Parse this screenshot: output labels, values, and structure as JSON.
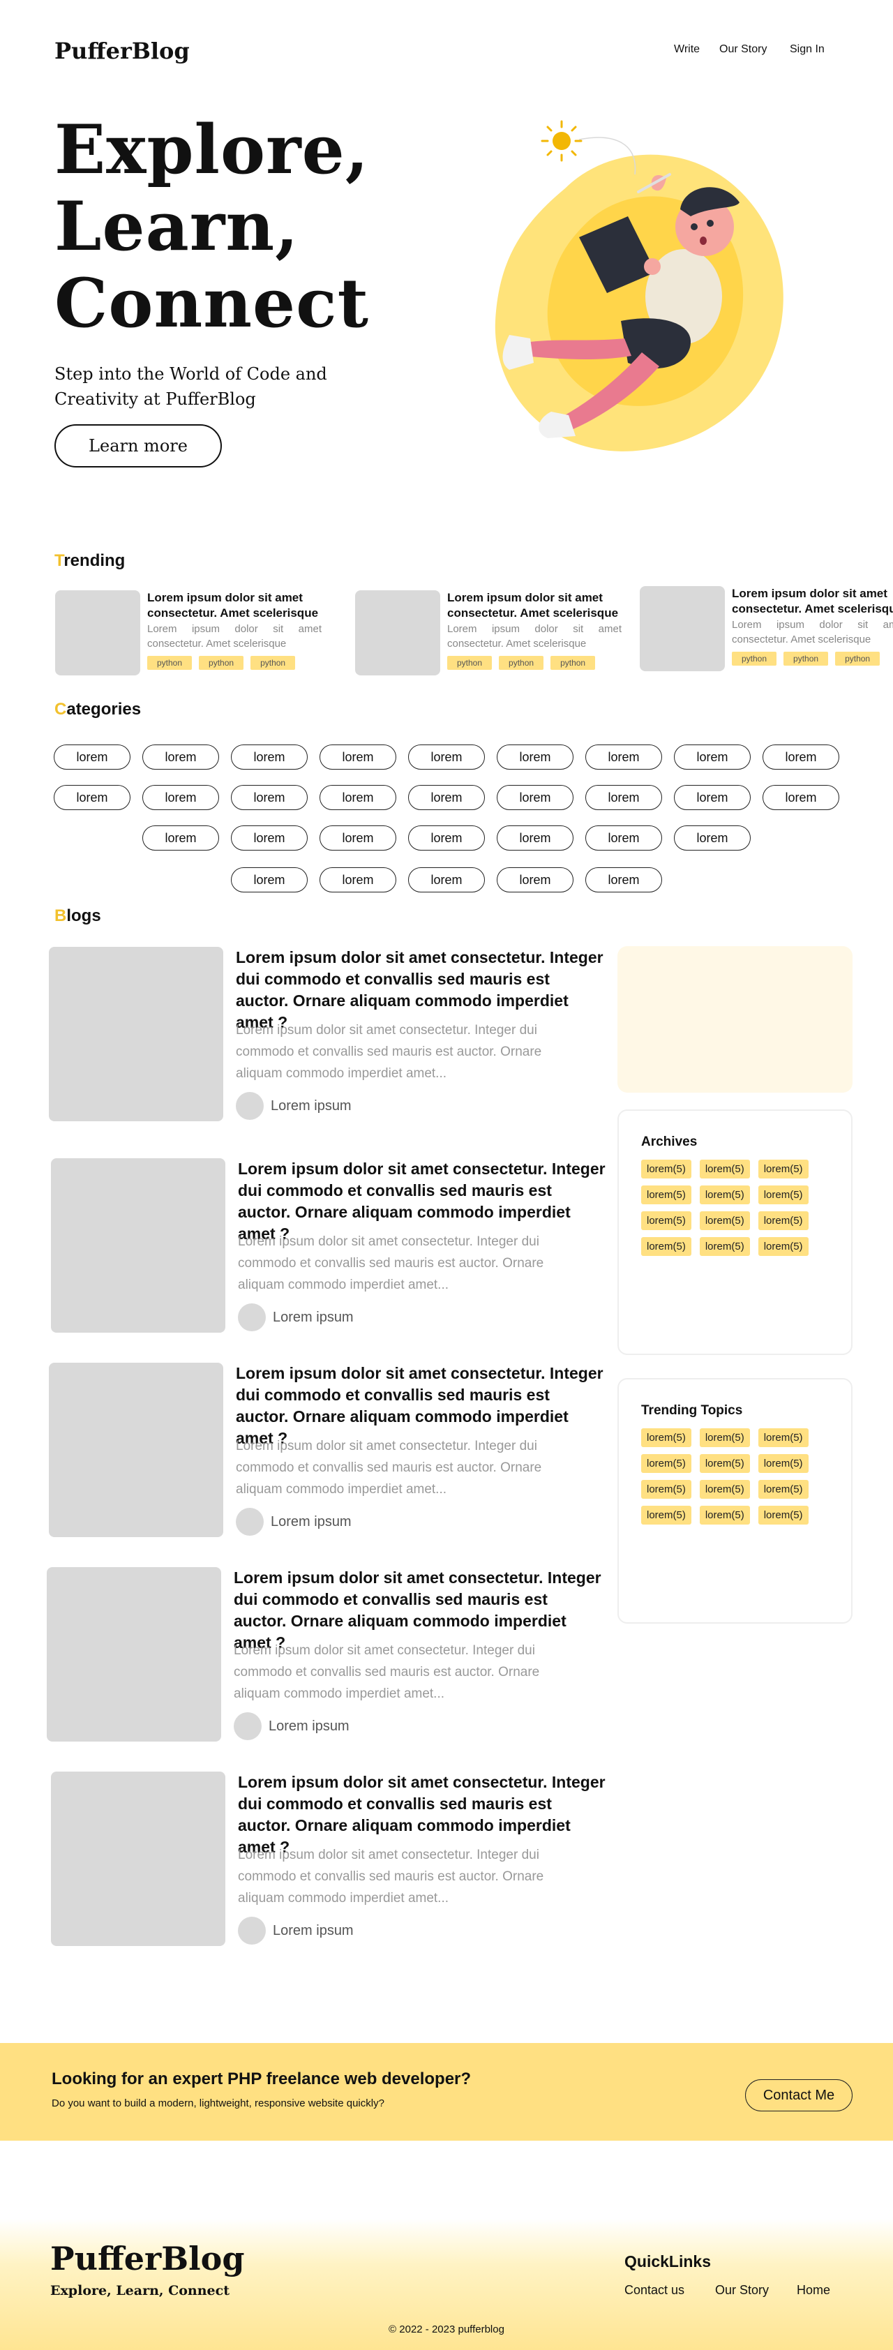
{
  "header": {
    "logo": "PufferBlog",
    "nav": [
      "Write",
      "Our Story",
      "Sign In"
    ]
  },
  "hero": {
    "title_lines": [
      "Explore,",
      "Learn,",
      "Connect"
    ],
    "subtitle": "Step into the World of Code and Creativity at PufferBlog",
    "button": "Learn more"
  },
  "trending": {
    "title_first": "T",
    "title_rest": "rending",
    "items": [
      {
        "title": "Lorem ipsum dolor sit amet consectetur. Amet scelerisque",
        "desc": "Lorem ipsum dolor sit amet consectetur. Amet scelerisque",
        "tags": [
          "python",
          "python",
          "python"
        ]
      },
      {
        "title": "Lorem ipsum dolor sit amet consectetur. Amet scelerisque",
        "desc": "Lorem ipsum dolor sit amet consectetur. Amet scelerisque",
        "tags": [
          "python",
          "python",
          "python"
        ]
      },
      {
        "title": "Lorem ipsum dolor sit amet consectetur. Amet scelerisque",
        "desc": "Lorem ipsum dolor sit amet consectetur. Amet scelerisque",
        "tags": [
          "python",
          "python",
          "python"
        ]
      }
    ]
  },
  "categories": {
    "title_first": "C",
    "title_rest": "ategories",
    "rows": [
      [
        "lorem",
        "lorem",
        "lorem",
        "lorem",
        "lorem",
        "lorem",
        "lorem",
        "lorem",
        "lorem"
      ],
      [
        "lorem",
        "lorem",
        "lorem",
        "lorem",
        "lorem",
        "lorem",
        "lorem",
        "lorem",
        "lorem"
      ],
      [
        "lorem",
        "lorem",
        "lorem",
        "lorem",
        "lorem",
        "lorem",
        "lorem"
      ],
      [
        "lorem",
        "lorem",
        "lorem",
        "lorem",
        "lorem"
      ]
    ]
  },
  "blogs": {
    "title_first": "B",
    "title_rest": "logs",
    "items": [
      {
        "title": "Lorem ipsum dolor sit amet consectetur. Integer dui commodo et convallis sed mauris est auctor. Ornare aliquam commodo imperdiet amet ?",
        "desc": "Lorem ipsum dolor sit amet consectetur. Integer dui commodo et convallis sed mauris est auctor. Ornare aliquam commodo imperdiet amet...",
        "author": "Lorem ipsum"
      },
      {
        "title": "Lorem ipsum dolor sit amet consectetur. Integer dui commodo et convallis sed mauris est auctor. Ornare aliquam commodo imperdiet amet ?",
        "desc": "Lorem ipsum dolor sit amet consectetur. Integer dui commodo et convallis sed mauris est auctor. Ornare aliquam commodo imperdiet amet...",
        "author": "Lorem ipsum"
      },
      {
        "title": "Lorem ipsum dolor sit amet consectetur. Integer dui commodo et convallis sed mauris est auctor. Ornare aliquam commodo imperdiet amet ?",
        "desc": "Lorem ipsum dolor sit amet consectetur. Integer dui commodo et convallis sed mauris est auctor. Ornare aliquam commodo imperdiet amet...",
        "author": "Lorem ipsum"
      },
      {
        "title": "Lorem ipsum dolor sit amet consectetur. Integer dui commodo et convallis sed mauris est auctor. Ornare aliquam commodo imperdiet amet ?",
        "desc": "Lorem ipsum dolor sit amet consectetur. Integer dui commodo et convallis sed mauris est auctor. Ornare aliquam commodo imperdiet amet...",
        "author": "Lorem ipsum"
      },
      {
        "title": "Lorem ipsum dolor sit amet consectetur. Integer dui commodo et convallis sed mauris est auctor. Ornare aliquam commodo imperdiet amet ?",
        "desc": "Lorem ipsum dolor sit amet consectetur. Integer dui commodo et convallis sed mauris est auctor. Ornare aliquam commodo imperdiet amet...",
        "author": "Lorem ipsum"
      }
    ]
  },
  "sidebar": {
    "archives": {
      "title": "Archives",
      "tags": [
        "lorem(5)",
        "lorem(5)",
        "lorem(5)",
        "lorem(5)",
        "lorem(5)",
        "lorem(5)",
        "lorem(5)",
        "lorem(5)",
        "lorem(5)",
        "lorem(5)",
        "lorem(5)",
        "lorem(5)"
      ]
    },
    "topics": {
      "title": "Trending Topics",
      "tags": [
        "lorem(5)",
        "lorem(5)",
        "lorem(5)",
        "lorem(5)",
        "lorem(5)",
        "lorem(5)",
        "lorem(5)",
        "lorem(5)",
        "lorem(5)",
        "lorem(5)",
        "lorem(5)",
        "lorem(5)"
      ]
    }
  },
  "cta": {
    "title": "Looking for an expert PHP freelance web developer?",
    "subtitle": "Do you want to build a modern, lightweight, responsive website quickly?",
    "button": "Contact Me"
  },
  "footer": {
    "logo": "PufferBlog",
    "tagline": "Explore, Learn, Connect",
    "quicklinks_title": "QuickLinks",
    "links": [
      "Contact us",
      "Our Story",
      "Home"
    ],
    "copyright": "© 2022 - 2023 pufferblog"
  },
  "colors": {
    "accent": "#f2c12e",
    "tag_bg": "#ffe082",
    "cta_bg": "#ffe082",
    "placeholder": "#d9d9d9"
  }
}
